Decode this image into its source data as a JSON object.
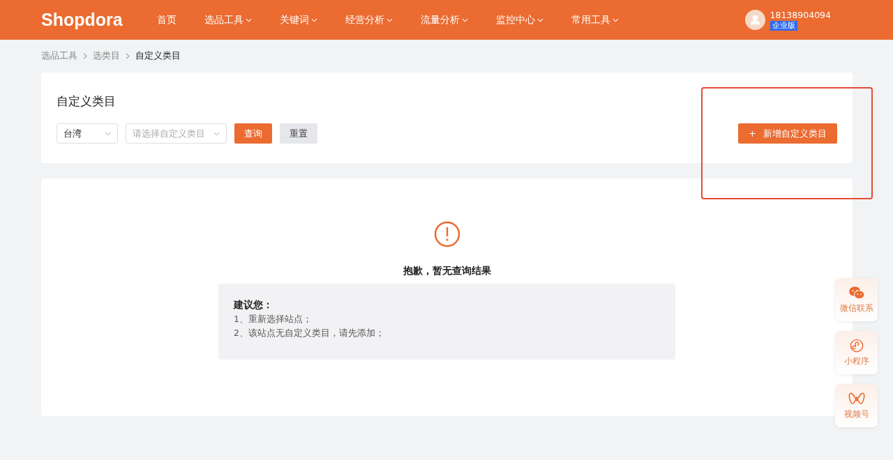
{
  "header": {
    "logo": "Shopdora",
    "nav": [
      {
        "label": "首页",
        "has_menu": false
      },
      {
        "label": "选品工具",
        "has_menu": true
      },
      {
        "label": "关键词",
        "has_menu": true
      },
      {
        "label": "经营分析",
        "has_menu": true
      },
      {
        "label": "流量分析",
        "has_menu": true
      },
      {
        "label": "监控中心",
        "has_menu": true
      },
      {
        "label": "常用工具",
        "has_menu": true
      }
    ],
    "user": {
      "phone": "18138904094",
      "plan": "企业版"
    }
  },
  "breadcrumb": [
    {
      "label": "选品工具",
      "current": false
    },
    {
      "label": "选类目",
      "current": false
    },
    {
      "label": "自定义类目",
      "current": true
    }
  ],
  "filter_card": {
    "title": "自定义类目",
    "site_select": {
      "value": "台湾"
    },
    "category_select": {
      "placeholder": "请选择自定义类目"
    },
    "query_button": "查询",
    "reset_button": "重置",
    "add_button": {
      "icon": "+",
      "label": "新增自定义类目"
    }
  },
  "empty_state": {
    "message": "抱歉，暂无查询结果",
    "suggestion_title": "建议您：",
    "suggestions": [
      "1、重新选择站点；",
      "2、该站点无自定义类目，请先添加；"
    ]
  },
  "float_bar": [
    {
      "kind": "wechat",
      "label": "微信联系"
    },
    {
      "kind": "miniapp",
      "label": "小程序"
    },
    {
      "kind": "video",
      "label": "视频号"
    }
  ]
}
